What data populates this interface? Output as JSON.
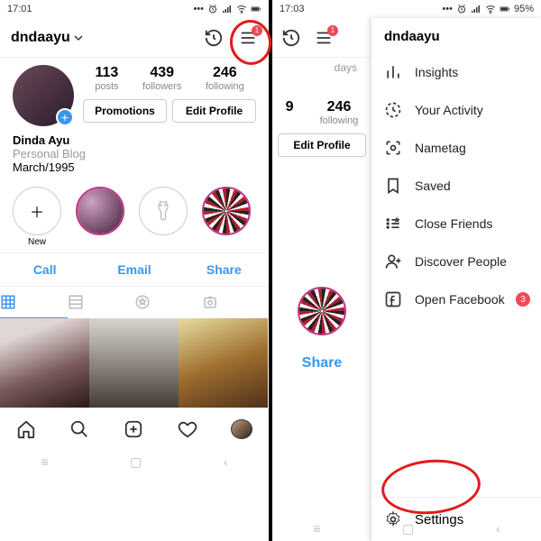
{
  "left": {
    "status_time": "17:01",
    "username": "dndaayu",
    "menu_badge": "1",
    "stats": [
      {
        "n": "113",
        "l": "posts"
      },
      {
        "n": "439",
        "l": "followers"
      },
      {
        "n": "246",
        "l": "following"
      }
    ],
    "promotions": "Promotions",
    "edit_profile": "Edit Profile",
    "display_name": "Dinda Ayu",
    "category": "Personal Blog",
    "extra": "March/1995",
    "highlight_new": "New",
    "contacts": {
      "call": "Call",
      "email": "Email",
      "share": "Share"
    }
  },
  "right": {
    "status_time": "17:03",
    "battery": "95%",
    "menu_badge": "1",
    "days": "days",
    "stats": [
      {
        "n": "9",
        "l": ""
      },
      {
        "n": "246",
        "l": "following"
      }
    ],
    "edit_profile": "Edit Profile",
    "share": "Share",
    "drawer_title": "dndaayu",
    "items": [
      {
        "label": "Insights"
      },
      {
        "label": "Your Activity"
      },
      {
        "label": "Nametag"
      },
      {
        "label": "Saved"
      },
      {
        "label": "Close Friends"
      },
      {
        "label": "Discover People"
      },
      {
        "label": "Open Facebook",
        "badge": "3"
      }
    ],
    "settings": "Settings"
  }
}
